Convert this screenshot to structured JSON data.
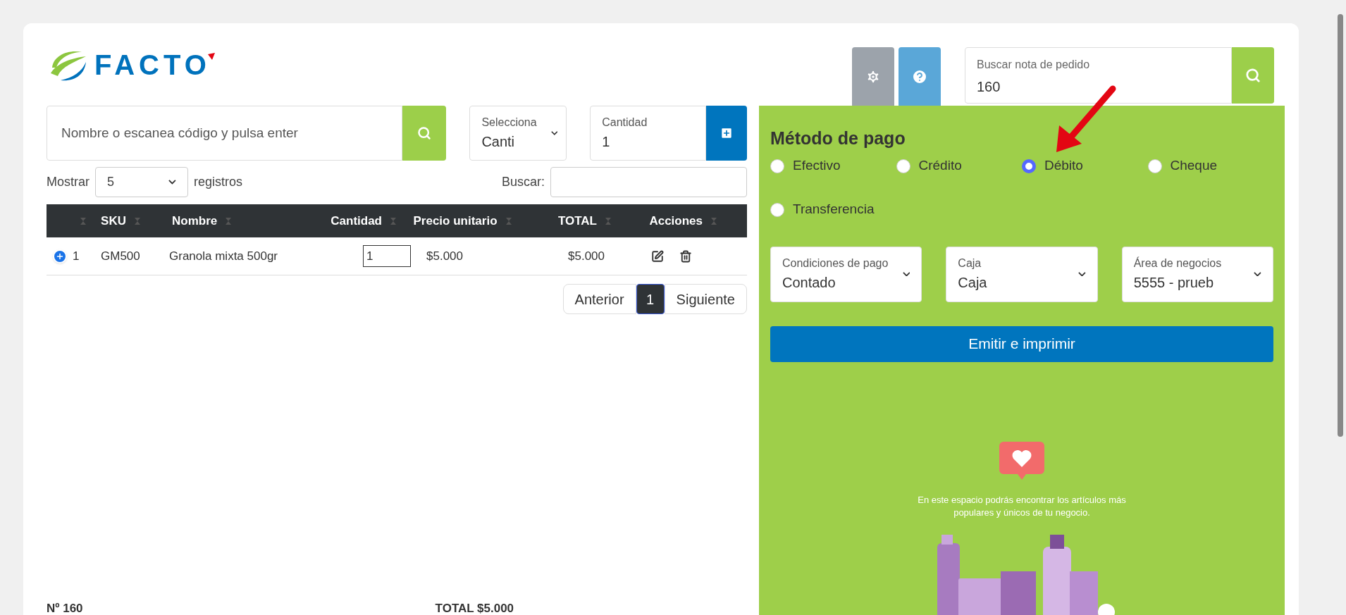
{
  "logo": {
    "text": "FACTO"
  },
  "product_search": {
    "placeholder": "Nombre o escanea código y pulsa enter"
  },
  "type_select": {
    "label": "Selecciona",
    "value": "Canti"
  },
  "quantity": {
    "label": "Cantidad",
    "value": "1"
  },
  "show": {
    "label": "Mostrar",
    "value": "5",
    "suffix": "registros"
  },
  "table_search": {
    "label": "Buscar:"
  },
  "table": {
    "columns": [
      "SKU",
      "Nombre",
      "Cantidad",
      "Precio unitario",
      "TOTAL",
      "Acciones"
    ],
    "rows": [
      {
        "index": "1",
        "sku": "GM500",
        "name": "Granola mixta 500gr",
        "quantity": "1",
        "unit_price": "$5.000",
        "total": "$5.000"
      }
    ]
  },
  "pagination": {
    "previous": "Anterior",
    "pages": [
      {
        "label": "1",
        "selected": true
      }
    ],
    "next": "Siguiente"
  },
  "summary": {
    "number": "Nº 160",
    "total": "TOTAL $5.000"
  },
  "order_search": {
    "label": "Buscar nota de pedido",
    "value": "160"
  },
  "payment": {
    "title": "Método de pago",
    "methods": [
      {
        "label": "Efectivo",
        "selected": false
      },
      {
        "label": "Crédito",
        "selected": false
      },
      {
        "label": "Débito",
        "selected": true
      },
      {
        "label": "Cheque",
        "selected": false
      },
      {
        "label": "Transferencia",
        "selected": false
      }
    ],
    "selects": [
      {
        "label": "Condiciones de pago",
        "value": "Contado"
      },
      {
        "label": "Caja",
        "value": "Caja"
      },
      {
        "label": "Área de negocios",
        "value": "5555 - prueb"
      }
    ],
    "submit": "Emitir e imprimir"
  },
  "promo": {
    "text": "En este espacio podrás encontrar los artículos más populares y únicos de tu negocio."
  }
}
